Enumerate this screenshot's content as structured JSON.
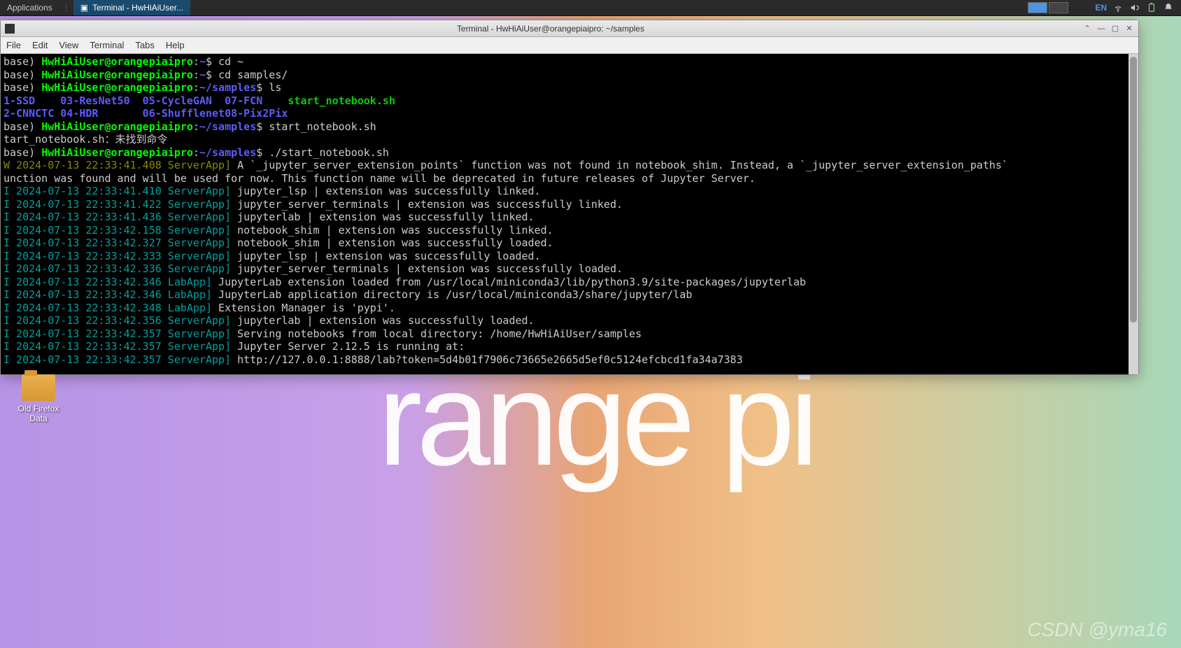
{
  "panel": {
    "applications": "Applications",
    "taskbar_app": "Terminal - HwHiAiUser...",
    "lang": "EN"
  },
  "window": {
    "title": "Terminal - HwHiAiUser@orangepiaipro: ~/samples",
    "menubar": [
      "File",
      "Edit",
      "View",
      "Terminal",
      "Tabs",
      "Help"
    ]
  },
  "prompt": {
    "base": "base) ",
    "user_host": "HwHiAiUser@orangepiaipro",
    "colon": ":",
    "home": "~",
    "samples": "~/samples",
    "dollar": "$ "
  },
  "cmds": {
    "cd_home": "cd ~",
    "cd_samples": "cd samples/",
    "ls": "ls",
    "start1": "start_notebook.sh",
    "start2": "./start_notebook.sh",
    "notfound": "tart_notebook.sh：未找到命令"
  },
  "ls_output": {
    "row1": [
      "1-SSD",
      "03-ResNet50",
      "05-CycleGAN",
      "07-FCN",
      "start_notebook.sh"
    ],
    "row2": [
      "2-CNNCTC",
      "04-HDR",
      "06-Shufflenet",
      "08-Pix2Pix"
    ]
  },
  "log_warn": {
    "prefix": "W 2024-07-13 22:33:41.408 ServerApp]",
    "line1": " A `_jupyter_server_extension_points` function was not found in notebook_shim. Instead, a `_jupyter_server_extension_paths`  ",
    "line2": "unction was found and will be used for now. This function name will be deprecated in future releases of Jupyter Server."
  },
  "logs": [
    {
      "ts": "I 2024-07-13 22:33:41.410 ServerApp]",
      "msg": " jupyter_lsp | extension was successfully linked."
    },
    {
      "ts": "I 2024-07-13 22:33:41.422 ServerApp]",
      "msg": " jupyter_server_terminals | extension was successfully linked."
    },
    {
      "ts": "I 2024-07-13 22:33:41.436 ServerApp]",
      "msg": " jupyterlab | extension was successfully linked."
    },
    {
      "ts": "I 2024-07-13 22:33:42.158 ServerApp]",
      "msg": " notebook_shim | extension was successfully linked."
    },
    {
      "ts": "I 2024-07-13 22:33:42.327 ServerApp]",
      "msg": " notebook_shim | extension was successfully loaded."
    },
    {
      "ts": "I 2024-07-13 22:33:42.333 ServerApp]",
      "msg": " jupyter_lsp | extension was successfully loaded."
    },
    {
      "ts": "I 2024-07-13 22:33:42.336 ServerApp]",
      "msg": " jupyter_server_terminals | extension was successfully loaded."
    },
    {
      "ts": "I 2024-07-13 22:33:42.346 LabApp]",
      "msg": " JupyterLab extension loaded from /usr/local/miniconda3/lib/python3.9/site-packages/jupyterlab"
    },
    {
      "ts": "I 2024-07-13 22:33:42.346 LabApp]",
      "msg": " JupyterLab application directory is /usr/local/miniconda3/share/jupyter/lab"
    },
    {
      "ts": "I 2024-07-13 22:33:42.348 LabApp]",
      "msg": " Extension Manager is 'pypi'."
    },
    {
      "ts": "I 2024-07-13 22:33:42.356 ServerApp]",
      "msg": " jupyterlab | extension was successfully loaded."
    },
    {
      "ts": "I 2024-07-13 22:33:42.357 ServerApp]",
      "msg": " Serving notebooks from local directory: /home/HwHiAiUser/samples"
    },
    {
      "ts": "I 2024-07-13 22:33:42.357 ServerApp]",
      "msg": " Jupyter Server 2.12.5 is running at:"
    },
    {
      "ts": "I 2024-07-13 22:33:42.357 ServerApp]",
      "msg": " http://127.0.0.1:8888/lab?token=5d4b01f7906c73665e2665d5ef0c5124efcbcd1fa34a7383"
    }
  ],
  "desktop": {
    "icon_label": "Old Firefox\nData"
  },
  "watermark": "CSDN @yma16",
  "bg_logo": "range pi"
}
